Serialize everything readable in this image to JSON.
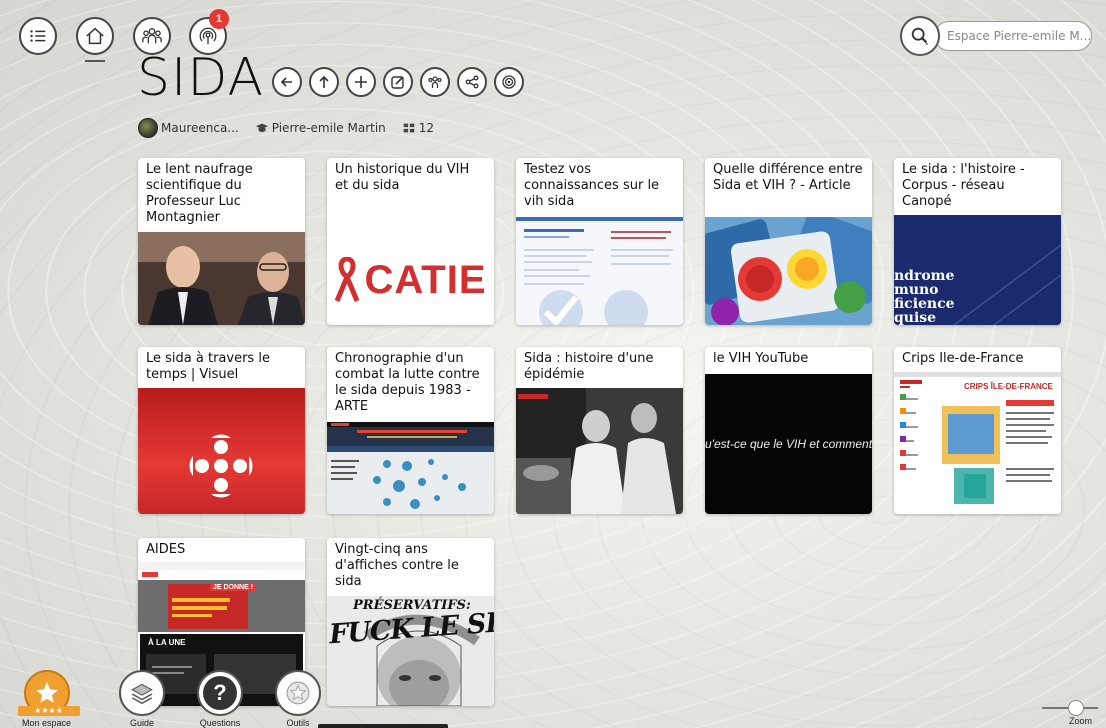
{
  "nav": {
    "notification_count": "1",
    "search_placeholder": "Espace Pierre-emile M..."
  },
  "page": {
    "title": "SIDA",
    "author": "Maureenca...",
    "owner": "Pierre-emile Martin",
    "item_count": "12"
  },
  "cards": [
    {
      "title": "Le lent naufrage scientifique du Professeur Luc Montagnier",
      "image": "photo-two-men"
    },
    {
      "title": "Un historique du VIH et du sida",
      "image": "catie-logo",
      "logo_text": "CATIE"
    },
    {
      "title": "Testez vos connaissances sur le vih sida",
      "image": "quiz-document"
    },
    {
      "title": "Quelle différence entre Sida et VIH ? - Article",
      "image": "condoms-photo"
    },
    {
      "title": "Le sida : l'histoire - Corpus - réseau Canopé",
      "image": "blue-text-cover",
      "cover_text": "ndrome\nmuno\nficience\nquise"
    },
    {
      "title": "Le sida à travers le temps | Visuel",
      "image": "radio-canada-logo"
    },
    {
      "title": "Chronographie d'un combat la lutte contre le sida depuis 1983 - ARTE",
      "image": "arte-timeline"
    },
    {
      "title": "Sida : histoire d'une épidémie",
      "image": "hospital-photo"
    },
    {
      "title": "le VIH YouTube",
      "image": "video-still",
      "caption": "u'est-ce que le VIH et comment nous nuit-il"
    },
    {
      "title": "Crips Ile-de-France",
      "image": "crips-website",
      "heading": "CRIPS ÎLE-DE-FRANCE"
    },
    {
      "title": "AIDES",
      "image": "aides-website",
      "tag": "JE DONNE !",
      "section": "À LA UNE"
    },
    {
      "title": "Vingt-cinq ans d'affiches contre le sida",
      "image": "poster",
      "top_text": "PRÉSERVATIFS:",
      "big_text": "FUCK LE SIDA"
    }
  ],
  "dock": {
    "mon_espace": "Mon espace",
    "guide": "Guide",
    "questions": "Questions",
    "outils": "Outils",
    "zoom": "Zoom"
  },
  "colors": {
    "accent_orange": "#f0a030",
    "badge_red": "#e53935",
    "catie_red": "#d32f2f",
    "canope_blue": "#1a2a6c"
  }
}
